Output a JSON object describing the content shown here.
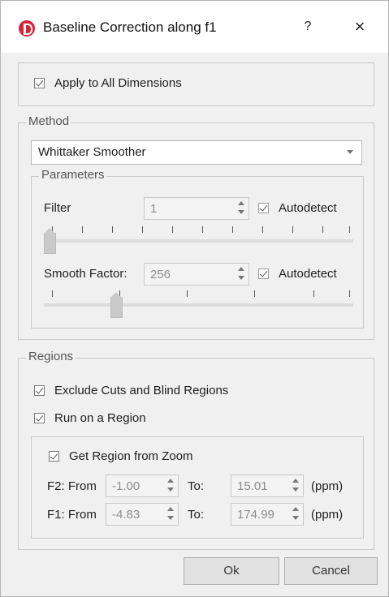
{
  "window": {
    "title": "Baseline Correction along f1",
    "help_label": "?",
    "close_label": "×",
    "app_icon": "red-app-logo"
  },
  "apply_all": {
    "label": "Apply to All Dimensions",
    "checked": true
  },
  "method": {
    "legend": "Method",
    "selected": "Whittaker Smoother",
    "parameters": {
      "legend": "Parameters",
      "filter": {
        "label": "Filter",
        "value": "1",
        "autodetect_label": "Autodetect",
        "autodetect_checked": true,
        "slider_level": 0
      },
      "smooth_factor": {
        "label": "Smooth Factor:",
        "value": "256",
        "autodetect_label": "Autodetect",
        "autodetect_checked": true,
        "slider_level": 0.22
      }
    }
  },
  "regions": {
    "legend": "Regions",
    "exclude_cuts": {
      "label": "Exclude Cuts and Blind Regions",
      "checked": true
    },
    "run_on_region": {
      "label": "Run on a Region",
      "checked": true
    },
    "get_from_zoom": {
      "label": "Get Region from Zoom",
      "checked": true
    },
    "f2": {
      "label": "F2: From",
      "from": "-1.00",
      "to_label": "To:",
      "to": "15.01",
      "unit": "(ppm)"
    },
    "f1": {
      "label": "F1: From",
      "from": "-4.83",
      "to_label": "To:",
      "to": "174.99",
      "unit": "(ppm)"
    }
  },
  "buttons": {
    "ok": "Ok",
    "cancel": "Cancel"
  }
}
